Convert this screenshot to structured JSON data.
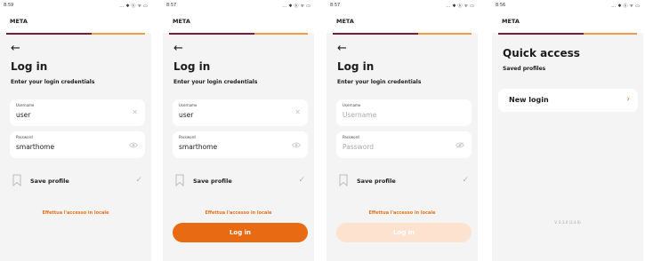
{
  "status_bars": [
    {
      "time": "8:59",
      "icons": "... ✱ ⓑ ᯤ ▭"
    },
    {
      "time": "8:57",
      "icons": "... ✱ ⓑ ᯤ ▭"
    },
    {
      "time": "8:57",
      "icons": "... ✱ ⓑ ᯤ ▭"
    },
    {
      "time": "8:56",
      "icons": "... ✱ ⓑ ᯤ ▭"
    }
  ],
  "app": {
    "brand": "META",
    "accent_color": "#e86a12",
    "brand_dark": "#7a1b3a"
  },
  "login": {
    "back": "←",
    "title": "Log in",
    "subtitle": "Enter your login credentials",
    "username_label": "Username",
    "password_label": "Password",
    "username_placeholder": "Username",
    "password_placeholder": "Password",
    "save_profile": "Save profile",
    "local_access": "Effettua l'accesso in locale",
    "login_button": "Log in"
  },
  "screens": [
    {
      "username": "user",
      "password": "smarthome",
      "show_button": false
    },
    {
      "username": "user",
      "password": "smarthome",
      "show_button": true,
      "button_enabled": true
    },
    {
      "username": "",
      "password": "",
      "show_button": true,
      "button_enabled": false
    }
  ],
  "quick_access": {
    "title": "Quick access",
    "subtitle": "Saved profiles",
    "new_login": "New login",
    "chevron": "›",
    "version": "V. 0.3.0 (3.4.0)"
  }
}
